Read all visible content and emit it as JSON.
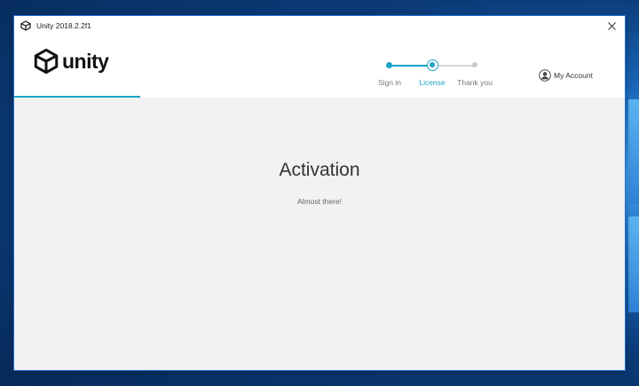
{
  "window": {
    "title": "Unity 2018.2.2f1"
  },
  "logo": {
    "text": "unity"
  },
  "stepper": {
    "steps": [
      {
        "label": "Sign in",
        "state": "complete"
      },
      {
        "label": "License",
        "state": "current"
      },
      {
        "label": "Thank you",
        "state": "upcoming"
      }
    ]
  },
  "account": {
    "label": "My Account"
  },
  "main": {
    "title": "Activation",
    "subtitle": "Almost there!"
  },
  "colors": {
    "accent": "#19a3c7",
    "content_bg": "#f2f2f2",
    "header_bg": "#ffffff"
  },
  "icons": {
    "app": "unity-logo-icon",
    "close": "close-icon",
    "account": "user-avatar-icon"
  }
}
